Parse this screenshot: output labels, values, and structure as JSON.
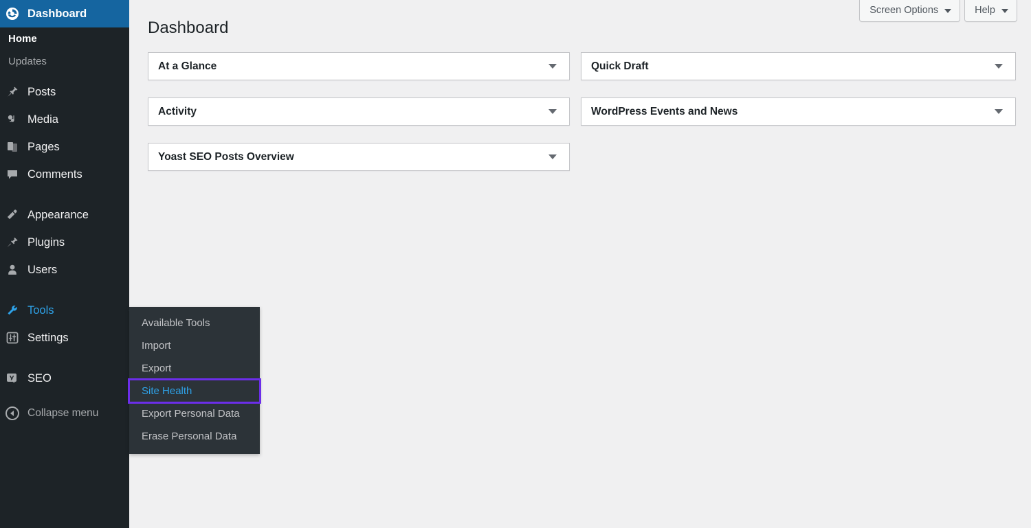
{
  "sidebar": {
    "items": [
      {
        "label": "Dashboard",
        "icon": "dashboard-icon",
        "state": "current-blue",
        "submenu": [
          {
            "label": "Home",
            "current": true
          },
          {
            "label": "Updates",
            "current": false
          }
        ]
      },
      {
        "label": "Posts",
        "icon": "pin-icon",
        "state": ""
      },
      {
        "label": "Media",
        "icon": "media-icon",
        "state": ""
      },
      {
        "label": "Pages",
        "icon": "pages-icon",
        "state": ""
      },
      {
        "label": "Comments",
        "icon": "comment-icon",
        "state": ""
      },
      {
        "label": "Appearance",
        "icon": "brush-icon",
        "state": ""
      },
      {
        "label": "Plugins",
        "icon": "plugin-icon",
        "state": ""
      },
      {
        "label": "Users",
        "icon": "user-icon",
        "state": ""
      },
      {
        "label": "Tools",
        "icon": "wrench-icon",
        "state": "current-dark"
      },
      {
        "label": "Settings",
        "icon": "settings-icon",
        "state": ""
      },
      {
        "label": "SEO",
        "icon": "yoast-icon",
        "state": ""
      }
    ],
    "collapse": {
      "label": "Collapse menu",
      "icon": "collapse-arrow-icon"
    }
  },
  "tools_flyout": {
    "items": [
      {
        "label": "Available Tools",
        "current": false,
        "focused": false
      },
      {
        "label": "Import",
        "current": false,
        "focused": false
      },
      {
        "label": "Export",
        "current": false,
        "focused": false
      },
      {
        "label": "Site Health",
        "current": true,
        "focused": true
      },
      {
        "label": "Export Personal Data",
        "current": false,
        "focused": false
      },
      {
        "label": "Erase Personal Data",
        "current": false,
        "focused": false
      }
    ]
  },
  "screen_meta": {
    "screen_options_label": "Screen Options",
    "help_label": "Help"
  },
  "page": {
    "title": "Dashboard"
  },
  "widgets": {
    "left": [
      {
        "title": "At a Glance"
      },
      {
        "title": "Activity"
      },
      {
        "title": "Yoast SEO Posts Overview"
      }
    ],
    "right": [
      {
        "title": "Quick Draft"
      },
      {
        "title": "WordPress Events and News"
      }
    ]
  },
  "colors": {
    "sidebar_bg": "#1d2327",
    "submenu_bg": "#2c3338",
    "current_blue": "#1565a0",
    "link_blue": "#2ea2e8",
    "focus_purple": "#6c2eea",
    "content_bg": "#f0f0f1"
  }
}
